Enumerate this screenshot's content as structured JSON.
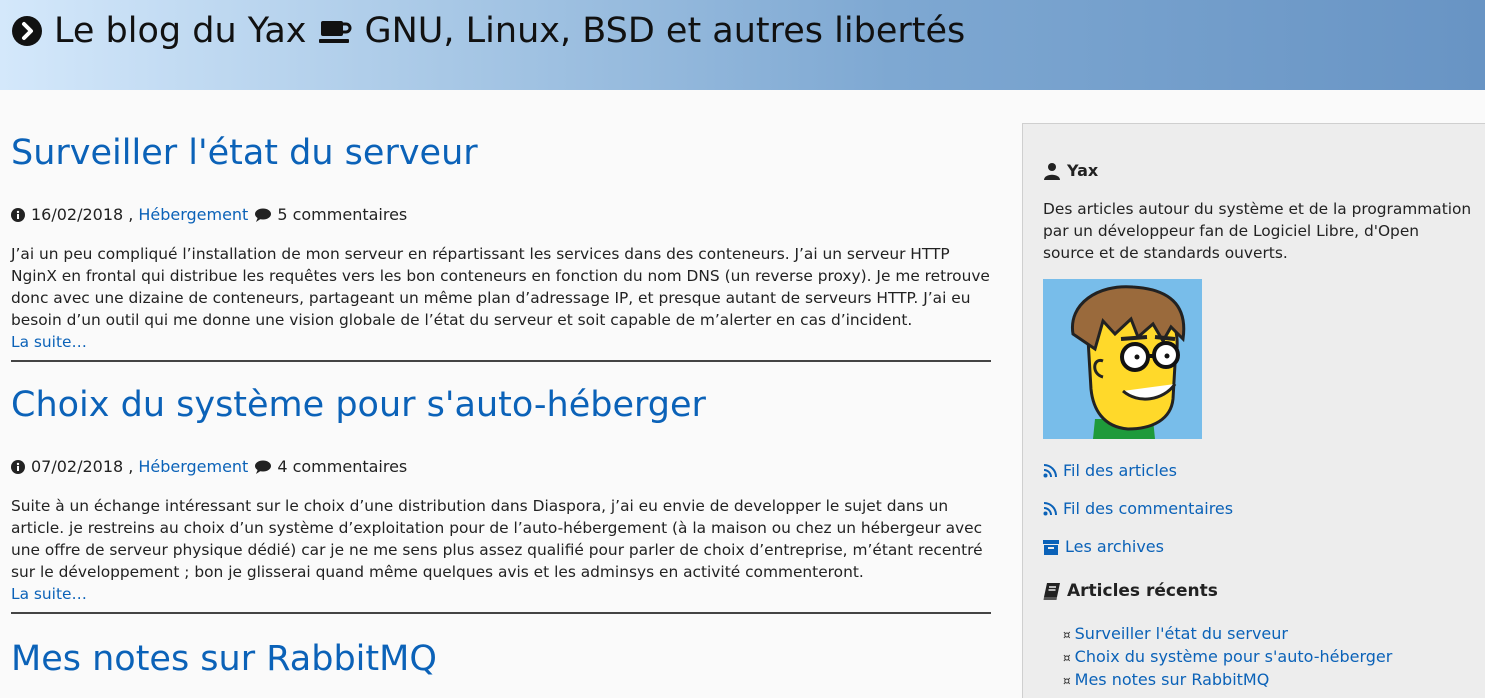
{
  "header": {
    "title_left": "Le blog du Yax",
    "title_right": "GNU, Linux, BSD et autres libertés",
    "icons": [
      "chevron-circle-right-icon",
      "coffee-cup-icon"
    ]
  },
  "articles": [
    {
      "title": "Surveiller l'état du serveur",
      "date": "16/02/2018",
      "category": "Hébergement",
      "comments": "5 commentaires",
      "summary": "J’ai un peu compliqué l’installation de mon serveur en répartissant les services dans des conteneurs. J’ai un serveur HTTP NginX en frontal qui distribue les requêtes vers les bon conteneurs en fonction du nom DNS (un reverse proxy). Je me retrouve donc avec une dizaine de conteneurs, partageant un même plan d’adressage IP, et presque autant de serveurs HTTP. J’ai eu besoin d’un outil qui me donne une vision globale de l’état du serveur et soit capable de m’alerter en cas d’incident.",
      "more": "La suite…"
    },
    {
      "title": "Choix du système pour s'auto-héberger",
      "date": "07/02/2018",
      "category": "Hébergement",
      "comments": "4 commentaires",
      "summary": "Suite à un échange intéressant sur le choix d’une distribution dans Diaspora, j’ai eu envie de developper le sujet dans un article. je restreins au choix d’un système d’exploitation pour de l’auto-hébergement (à la maison ou chez un hébergeur avec une offre de serveur physique dédié) car je ne me sens plus assez qualifié pour parler de choix d’entreprise, m’étant recentré sur le développement ; bon je glisserai quand même quelques avis et les adminsys en activité commenteront.",
      "more": "La suite…"
    },
    {
      "title": "Mes notes sur RabbitMQ"
    }
  ],
  "sidebar": {
    "author": "Yax",
    "description": "Des articles autour du système et de la programmation par un développeur fan de Logiciel Libre, d'Open source et de standards ouverts.",
    "links": {
      "feed_articles": "Fil des articles",
      "feed_comments": "Fil des commentaires",
      "archives": "Les archives"
    },
    "recent_title": "Articles récents",
    "recent": [
      "Surveiller l'état du serveur",
      "Choix du système pour s'auto-héberger",
      "Mes notes sur RabbitMQ"
    ],
    "bullet": "¤"
  },
  "colors": {
    "link": "#0b62b8",
    "header_gradient_start": "#d4e8fb",
    "header_gradient_end": "#6894c4",
    "sidebar_bg": "#ededed",
    "page_bg": "#fafafa"
  }
}
